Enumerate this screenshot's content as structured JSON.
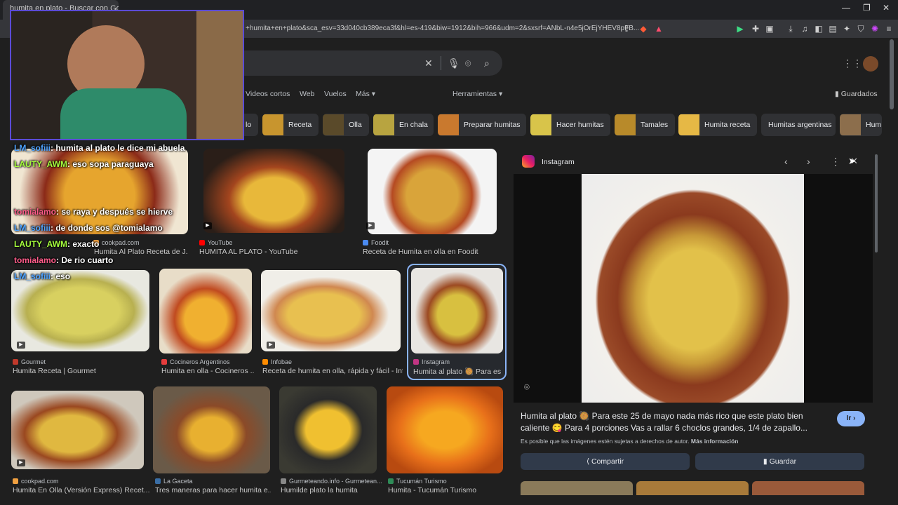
{
  "browser": {
    "tab_title": "humita en plato - Buscar con Go...",
    "url": "+humita+en+plato&sca_esv=33d040cb389eca3f&hl=es-419&biw=1912&bih=966&udm=2&sxsrf=ANbL-n4e5jOrEjYHEV8pFB..."
  },
  "google": {
    "nav_tabs": [
      "Videos cortos",
      "Web",
      "Vuelos",
      "Más"
    ],
    "tools": "Herramientas",
    "saved": "Guardados",
    "chips": [
      "lo",
      "Receta",
      "Olla",
      "En chala",
      "Preparar humitas",
      "Hacer humitas",
      "Tamales",
      "Humita receta",
      "Humitas argentinas",
      "Hum"
    ]
  },
  "results": [
    {
      "source": "cookpad.com",
      "title": "Humita Al Plato Receta de J..."
    },
    {
      "source": "YouTube",
      "title": "HUMITA AL PLATO - YouTube"
    },
    {
      "source": "Foodit",
      "title": "Receta de Humita en olla en Foodit"
    },
    {
      "source": "Gourmet",
      "title": "Humita Receta | Gourmet"
    },
    {
      "source": "Cocineros Argentinos",
      "title": "Humita en olla - Cocineros ..."
    },
    {
      "source": "Infobae",
      "title": "Receta de humita en olla, rápida y fácil - Inf..."
    },
    {
      "source": "Instagram",
      "title": "Humita al plato 🥘 Para es..."
    },
    {
      "source": "cookpad.com",
      "title": "Humita En Olla (Versión Express) Recet..."
    },
    {
      "source": "La Gaceta",
      "title": "Tres maneras para hacer humita e..."
    },
    {
      "source": "Gurmeteando.info - Gurmetean...",
      "title": "Humilde plato la humita"
    },
    {
      "source": "Tucumán Turismo",
      "title": "Humita - Tucumán Turismo"
    }
  ],
  "panel": {
    "source": "Instagram",
    "caption_line1": "Humita al plato 🥘 Para este 25 de mayo nada más rico que este plato bien",
    "caption_line2": "caliente 😋 Para 4 porciones Vas a rallar 6 choclos grandes, 1/4 de zapallo...",
    "copyright": "Es posible que las imágenes estén sujetas a derechos de autor.",
    "more_info": "Más información",
    "go_label": "Ir ›",
    "share_label": "Compartir",
    "save_label": "Guardar"
  },
  "chat": [
    {
      "user": "LM_sofiii",
      "msg": ": humita al plato le dice mi abuela"
    },
    {
      "user": "LAUTY_AWM",
      "msg": ": eso sopa paraguaya"
    },
    {
      "user": "tomialamo",
      "msg": ": se raya y después se hierve"
    },
    {
      "user": "LM_sofiii",
      "msg": ": de donde sos @tomialamo"
    },
    {
      "user": "LAUTY_AWM",
      "msg": ": exacto"
    },
    {
      "user": "tomialamo",
      "msg": ": De rio cuarto"
    },
    {
      "user": "LM_sofiii",
      "msg": ": eso"
    }
  ],
  "colors": {
    "accent": "#8ab4f8",
    "brand_purple": "#5b4bd6"
  }
}
